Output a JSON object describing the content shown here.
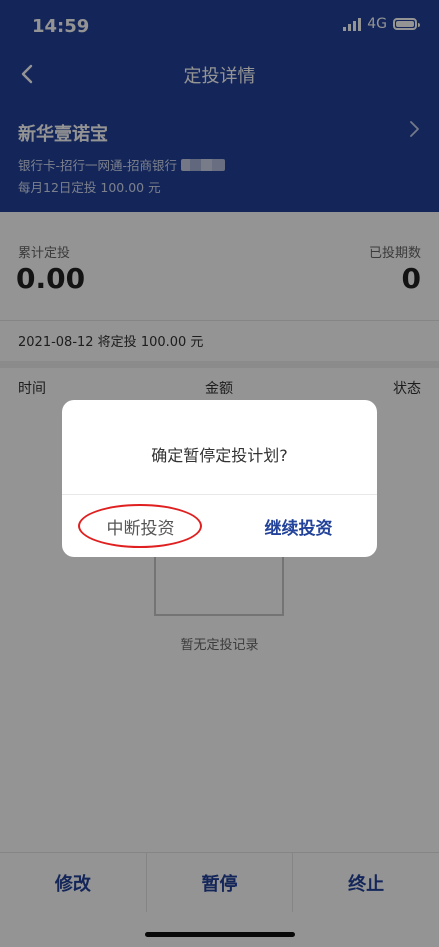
{
  "status_bar": {
    "time": "14:59",
    "network": "4G"
  },
  "nav": {
    "title": "定投详情"
  },
  "fund": {
    "name": "新华壹诺宝",
    "account": "银行卡-招行一网通-招商银行",
    "plan": "每月12日定投 100.00 元"
  },
  "summary": {
    "cumulative_label": "累计定投",
    "cumulative_value": "0.00",
    "periods_label": "已投期数",
    "periods_value": "0"
  },
  "next_investment": "2021-08-12 将定投 100.00 元",
  "table": {
    "columns": [
      "时间",
      "金额",
      "状态"
    ]
  },
  "empty_text": "暂无定投记录",
  "bottom_actions": [
    "修改",
    "暂停",
    "终止"
  ],
  "dialog": {
    "message": "确定暂停定投计划?",
    "interrupt_label": "中断投资",
    "continue_label": "继续投资"
  },
  "colors": {
    "brand": "#23439a",
    "highlight": "#e02020"
  }
}
